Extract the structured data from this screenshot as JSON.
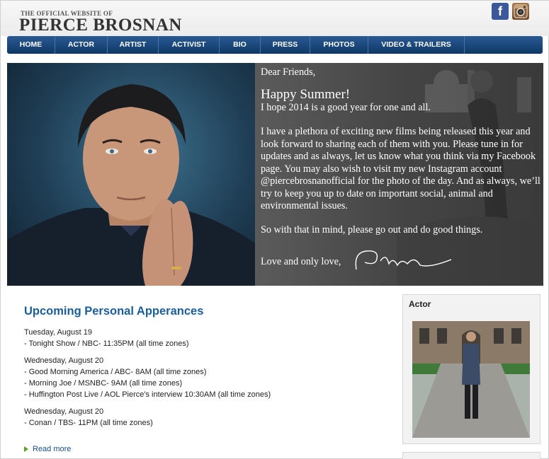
{
  "header": {
    "tagline": "THE OFFICIAL WEBSITE OF",
    "name": "PIERCE BROSNAN",
    "social": {
      "facebook_icon": "facebook-icon",
      "instagram_icon": "instagram-icon"
    }
  },
  "nav": {
    "items": [
      {
        "label": "HOME"
      },
      {
        "label": "ACTOR"
      },
      {
        "label": "ARTIST"
      },
      {
        "label": "ACTIVIST"
      },
      {
        "label": "BIO"
      },
      {
        "label": "PRESS"
      },
      {
        "label": "PHOTOS"
      },
      {
        "label": "VIDEO & TRAILERS"
      }
    ]
  },
  "hero": {
    "greeting": "Dear Friends,",
    "headline": "Happy Summer!",
    "line1": "I hope 2014 is a good year for one and all.",
    "body": "I have a plethora of exciting new films being released this year and look forward to sharing each of them with you. Please tune in for updates and as always, let us know what you think via my Facebook page. You may also wish to visit my new Instagram account @piercebrosnanofficial for the photo of the day. And as always, we’ll try to keep you up to date on important social, animal and environmental issues.",
    "closing": "So with that in mind, please go out and do good things.",
    "signoff": "Love and only love,",
    "signature": "Pierce"
  },
  "appearances": {
    "title": "Upcoming Personal Apperances",
    "groups": [
      {
        "date": "Tuesday, August 19",
        "items": [
          "- Tonight Show / NBC- 11:35PM (all time zones)"
        ]
      },
      {
        "date": "Wednesday, August 20",
        "items": [
          "- Good Morning America / ABC- 8AM (all time zones)",
          "- Morning Joe / MSNBC- 9AM (all time zones)",
          "- Huffington Post Live / AOL Pierce's interview 10:30AM (all time zones)"
        ]
      },
      {
        "date": "Wednesday, August 20",
        "items": [
          "- Conan / TBS- 11PM (all time zones)"
        ]
      }
    ],
    "read_more": "Read more"
  },
  "sidebar": {
    "title": "Actor"
  },
  "colors": {
    "nav_blue": "#0e3866",
    "title_blue": "#1b5e9a",
    "arrow_green": "#5aa02c"
  }
}
